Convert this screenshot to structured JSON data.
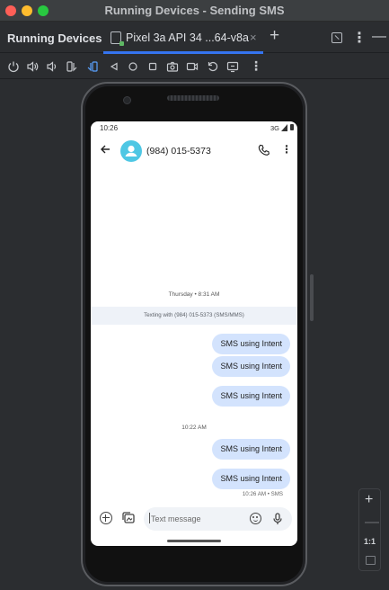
{
  "window": {
    "title": "Running Devices - Sending SMS"
  },
  "tool_window": {
    "title": "Running Devices",
    "tab_label": "Pixel 3a API 34 ...64-v8a",
    "tab_close": "×",
    "add_tab": "+",
    "more": "⋮",
    "minimize": "—"
  },
  "device_toolbar": {
    "icons": [
      "power-icon",
      "volume-up-icon",
      "volume-down-icon",
      "rotate-left-icon",
      "rotate-right-icon",
      "back-icon",
      "home-icon",
      "overview-icon",
      "screenshot-icon",
      "screen-record-icon",
      "reset-icon",
      "more-icon"
    ]
  },
  "phone": {
    "status_bar": {
      "time": "10:26",
      "network": "3G"
    },
    "app_bar": {
      "contact": "(984) 015-5373"
    },
    "conversation": {
      "date_header": "Thursday • 8:31 AM",
      "banner": "Texting with (984) 015-5373 (SMS/MMS)",
      "messages_group1": [
        "SMS using Intent",
        "SMS using Intent",
        "SMS using Intent"
      ],
      "time_header_2": "10:22 AM",
      "messages_group2": [
        "SMS using Intent",
        "SMS using Intent"
      ],
      "last_meta": "10:26 AM • SMS"
    },
    "composer": {
      "placeholder": "Text message"
    }
  },
  "zoom_controls": {
    "zoom_in": "+",
    "zoom_out": "—",
    "actual_size": "1:1"
  },
  "colors": {
    "accent": "#3574f0",
    "bubble": "#d3e3fd",
    "avatar": "#4ec7e4"
  }
}
